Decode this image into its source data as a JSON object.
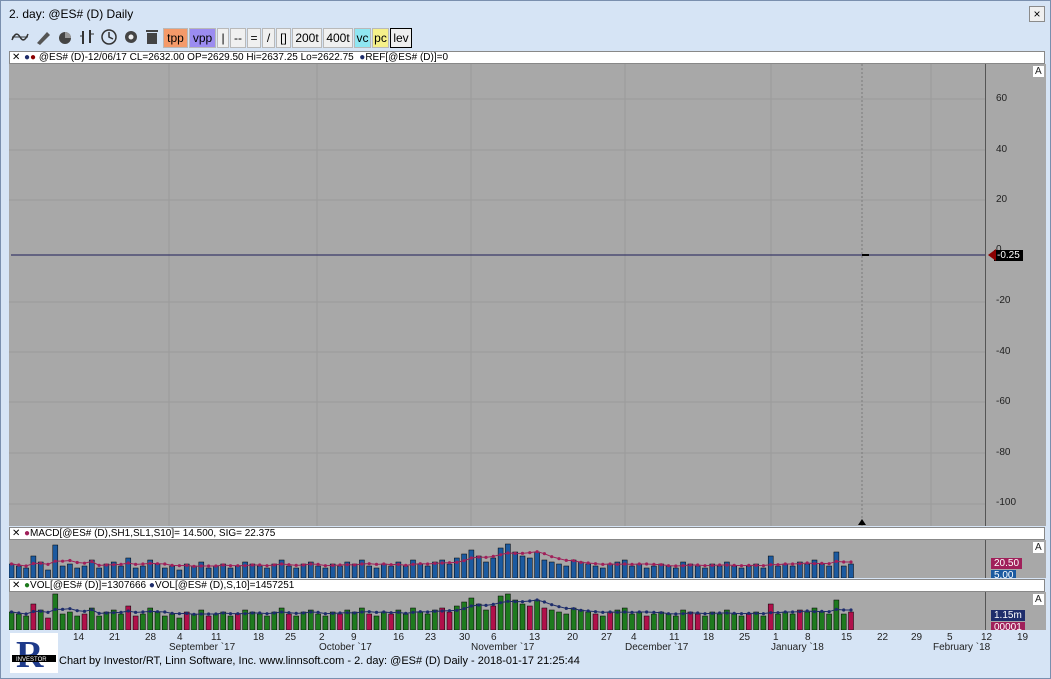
{
  "window": {
    "title": "2. day: @ES# (D) Daily",
    "close_label": "×"
  },
  "toolbar": {
    "buttons": [
      "tpp",
      "vpp",
      "|",
      "--",
      "=",
      "/",
      "[]",
      "200t",
      "400t",
      "vc",
      "pc",
      "lev"
    ],
    "colors": {
      "tpp": "#f49a6a",
      "vpp": "#9b8cf0",
      "vc": "#8fe6f2",
      "pc": "#f5f08a",
      "lev": "#eeeeee"
    }
  },
  "main_panel": {
    "legend": "@ES# (D)-12/06/17 CL=2632.00 OP=2629.50 Hi=2637.25 Lo=2622.75",
    "legend2": "REF[@ES# (D)]=0",
    "scale_marker": "A",
    "y_ticks": [
      "60",
      "40",
      "20",
      "0",
      "-20",
      "-40",
      "-60",
      "-80",
      "-100"
    ],
    "current_value": "-0.25",
    "current_color": "#8b0000"
  },
  "macd_panel": {
    "legend": "MACD[@ES# (D),SH1,SL1,S10]=  14.500, SIG=  22.375",
    "scale_marker": "A",
    "value1": "20.50",
    "value2": "5.00",
    "value1_color": "#a0205a",
    "value2_color": "#1b5aa0"
  },
  "vol_panel": {
    "legend": "VOL[@ES# (D)]=1307666",
    "legend2": "VOL[@ES# (D),S,10]=1457251",
    "scale_marker": "A",
    "value1": "1.15m",
    "value2": "00001",
    "value1_color": "#1e2d6b",
    "value2_color": "#a0205a"
  },
  "x_axis": {
    "day_labels": [
      "14",
      "21",
      "28",
      "4",
      "11",
      "18",
      "25",
      "2",
      "9",
      "16",
      "23",
      "30",
      "6",
      "13",
      "20",
      "27",
      "4",
      "11",
      "18",
      "25",
      "1",
      "8",
      "15",
      "22",
      "29",
      "5",
      "12",
      "19"
    ],
    "month_labels": [
      "September `17",
      "October `17",
      "November `17",
      "December `17",
      "January `18",
      "February `18"
    ]
  },
  "footer": {
    "text": "Chart by Investor/RT, Linn Software, Inc. www.linnsoft.com - 2. day: @ES# (D) Daily - 2018-01-17 21:25:44"
  },
  "logo": {
    "letter": "R",
    "brand": "INVESTOR"
  }
}
